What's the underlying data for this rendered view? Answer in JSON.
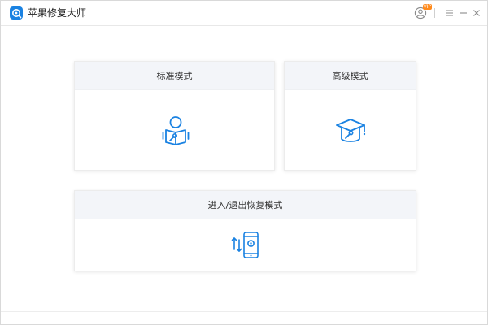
{
  "window": {
    "title": "苹果修复大师",
    "badge": "VIP",
    "icons": {
      "logo": "app-logo-icon",
      "user": "user-icon",
      "menu": "menu-icon",
      "minimize": "minimize-icon",
      "close": "close-icon"
    }
  },
  "modes": {
    "standard": {
      "label": "标准模式",
      "icon": "reader-wrench-icon"
    },
    "advanced": {
      "label": "高级模式",
      "icon": "graduation-cap-wrench-icon"
    },
    "recovery": {
      "label": "进入/退出恢复模式",
      "icon": "phone-arrows-icon"
    }
  },
  "colors": {
    "accent": "#1a82e2",
    "card_header": "#f3f5f9",
    "badge": "#ff8a1c"
  }
}
